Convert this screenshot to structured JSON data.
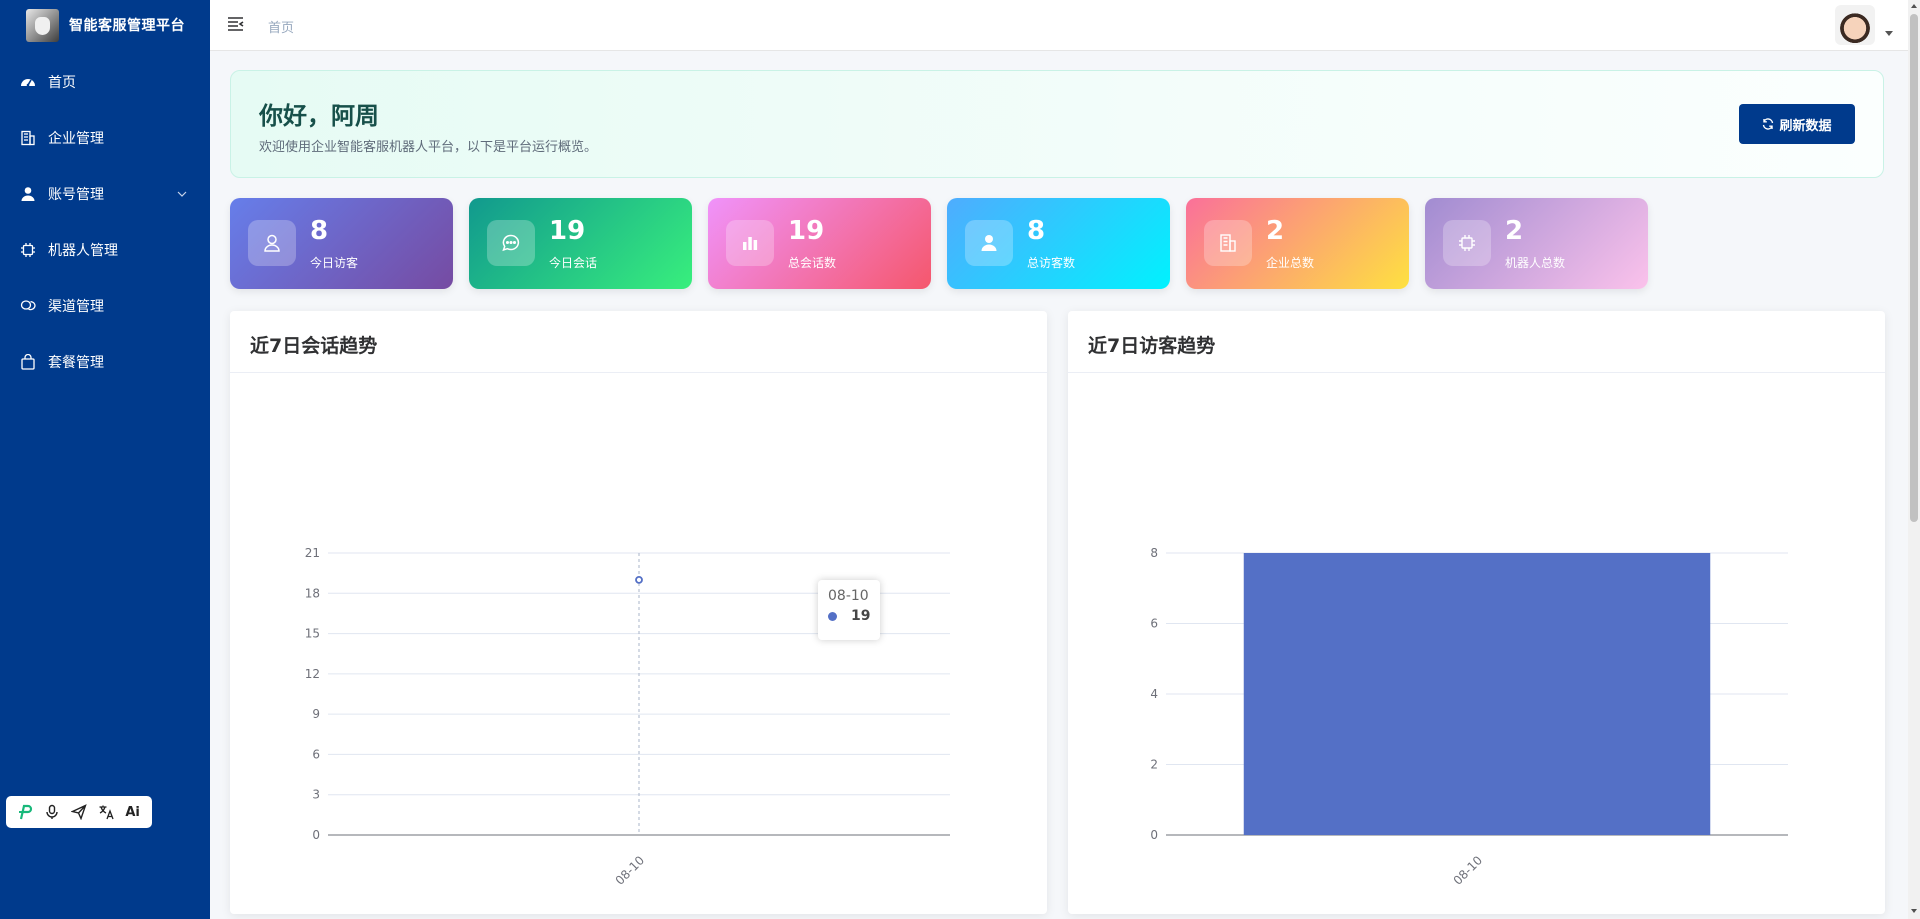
{
  "app": {
    "title": "智能客服管理平台"
  },
  "sidebar": {
    "items": [
      {
        "label": "首页",
        "icon": "dashboard-icon"
      },
      {
        "label": "企业管理",
        "icon": "building-icon"
      },
      {
        "label": "账号管理",
        "icon": "user-icon",
        "has_submenu": true
      },
      {
        "label": "机器人管理",
        "icon": "chip-icon"
      },
      {
        "label": "渠道管理",
        "icon": "channel-icon"
      },
      {
        "label": "套餐管理",
        "icon": "shopping-bag-icon"
      }
    ],
    "toolbar": [
      "p-logo-icon",
      "microphone-icon",
      "send-icon",
      "translate-icon",
      "ai-icon"
    ],
    "toolbar_ai_text": "Ai"
  },
  "header": {
    "breadcrumb": "首页"
  },
  "welcome": {
    "title": "你好，阿周",
    "subtitle": "欢迎使用企业智能客服机器人平台，以下是平台运行概览。",
    "refresh_label": "刷新数据"
  },
  "stats": [
    {
      "value": "8",
      "label": "今日访客",
      "icon": "user-outline-icon",
      "gradient": [
        "#667eea",
        "#764ba2"
      ]
    },
    {
      "value": "19",
      "label": "今日会话",
      "icon": "chat-bubble-icon",
      "gradient": [
        "#11998e",
        "#38ef7d"
      ]
    },
    {
      "value": "19",
      "label": "总会话数",
      "icon": "bar-chart-icon",
      "gradient": [
        "#f093fb",
        "#f5576c"
      ]
    },
    {
      "value": "8",
      "label": "总访客数",
      "icon": "person-icon",
      "gradient": [
        "#4facfe",
        "#00f2fe"
      ]
    },
    {
      "value": "2",
      "label": "企业总数",
      "icon": "building-icon",
      "gradient": [
        "#fa709a",
        "#fee140"
      ]
    },
    {
      "value": "2",
      "label": "机器人总数",
      "icon": "chip-icon",
      "gradient": [
        "#a18cd1",
        "#fbc2eb"
      ]
    }
  ],
  "charts": {
    "conversation": {
      "title": "近7日会话趋势"
    },
    "visitor": {
      "title": "近7日访客趋势"
    },
    "tooltip": {
      "date": "08-10",
      "value": "19"
    }
  },
  "chart_data": [
    {
      "type": "line",
      "title": "近7日会话趋势",
      "categories": [
        "08-10"
      ],
      "series": [
        {
          "values": [
            19
          ]
        }
      ],
      "ylim": [
        0,
        21
      ],
      "yticks": [
        0,
        3,
        6,
        9,
        12,
        15,
        18,
        21
      ],
      "color": "#5470c6",
      "grid": true
    },
    {
      "type": "bar",
      "title": "近7日访客趋势",
      "categories": [
        "08-10"
      ],
      "series": [
        {
          "values": [
            8
          ]
        }
      ],
      "ylim": [
        0,
        8
      ],
      "yticks": [
        0,
        2,
        4,
        6,
        8
      ],
      "color": "#5470c6",
      "grid": true
    }
  ]
}
